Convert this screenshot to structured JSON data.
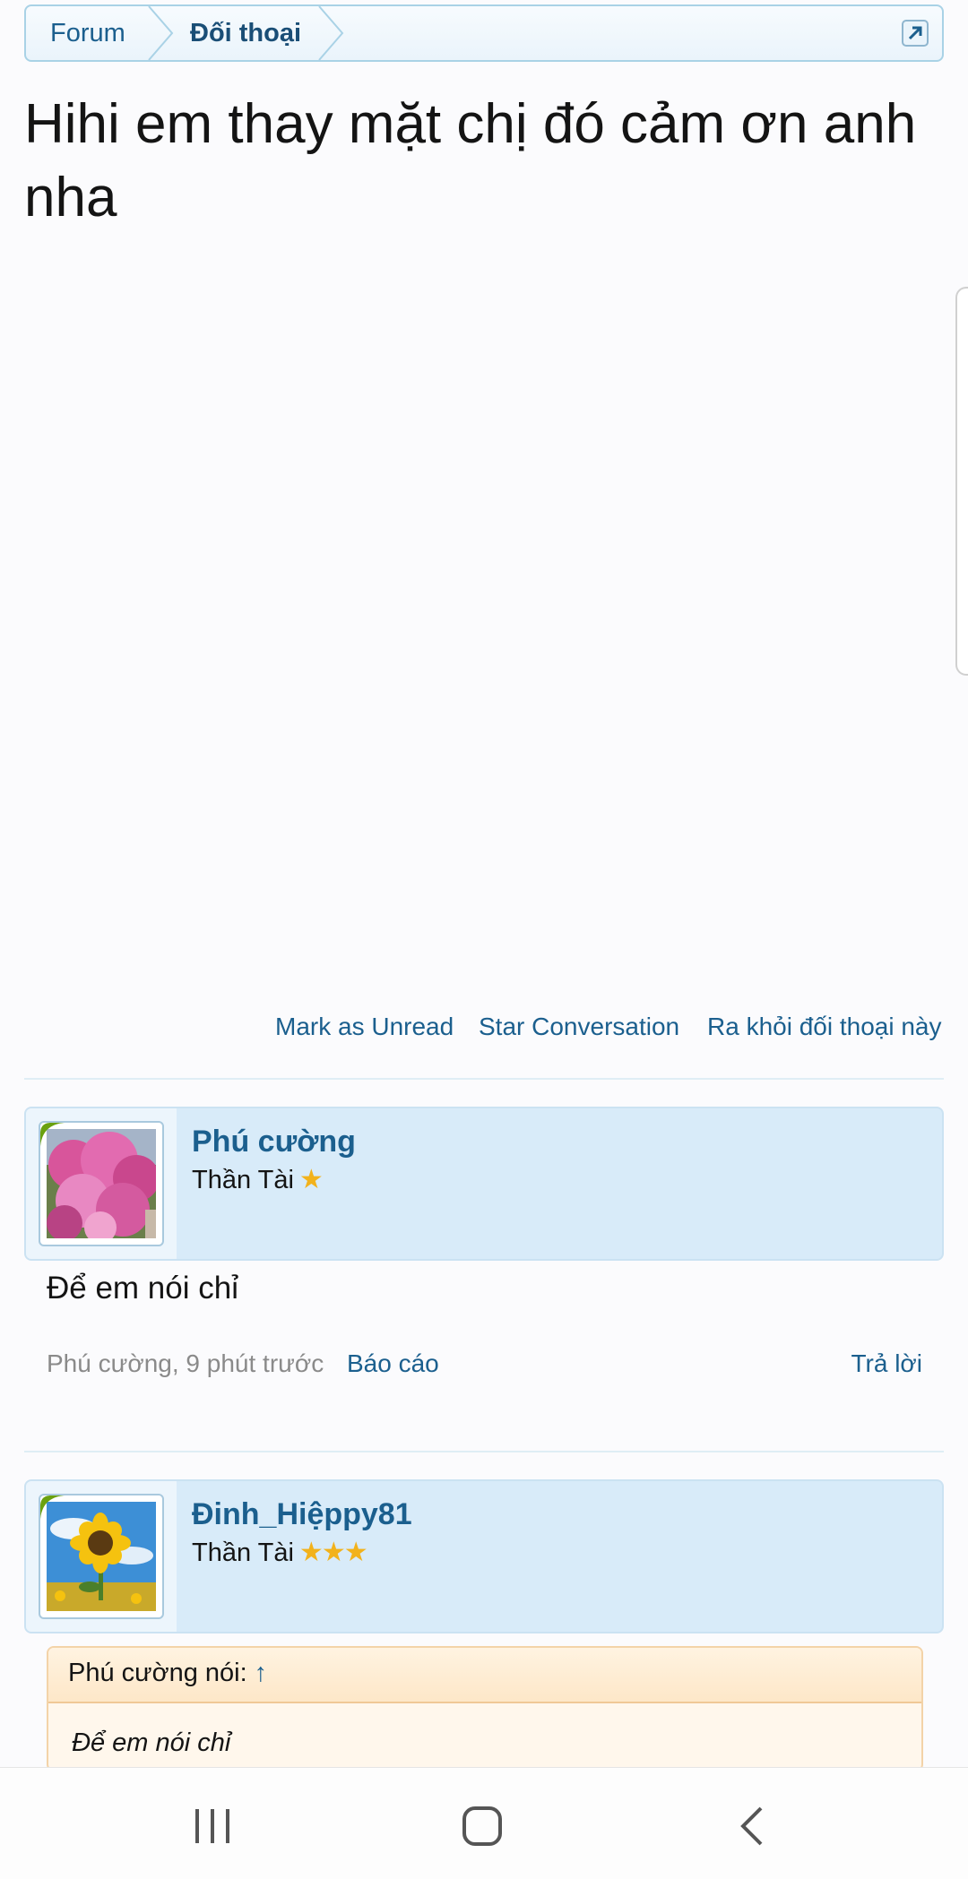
{
  "breadcrumb": {
    "items": [
      "Forum",
      "Đối thoại"
    ]
  },
  "page": {
    "title": "Hihi em thay mặt chị đó cảm ơn anh nha"
  },
  "actions": {
    "mark_unread": "Mark as Unread",
    "star": "Star Conversation",
    "leave": "Ra khỏi đối thoại này"
  },
  "messages": [
    {
      "username": "Phú cường",
      "user_title": "Thần Tài",
      "stars": "★",
      "avatar": "pink-flowers",
      "body": "Để em nói chỉ",
      "meta": "Phú cường, 9 phút trước",
      "report": "Báo cáo",
      "reply": "Trả lời"
    },
    {
      "username": "Đinh_Hiệppy81",
      "user_title": "Thần Tài",
      "stars": "★★★",
      "avatar": "sunflower",
      "quote": {
        "author": "Phú cường nói:",
        "arrow": "↑",
        "text": "Để em nói chỉ"
      }
    }
  ],
  "colors": {
    "link": "#1b5f8e",
    "header_bg": "#d8ebf9",
    "quote_bg": "#fff7ec",
    "star": "#f2b21c"
  }
}
